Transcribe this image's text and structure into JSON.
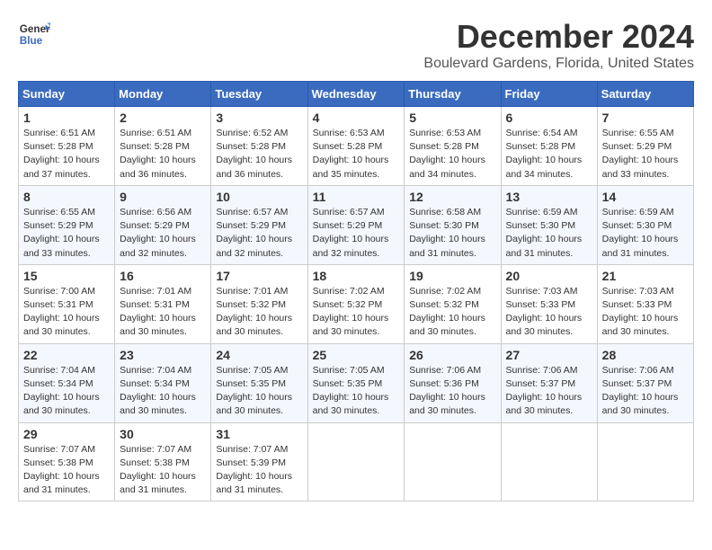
{
  "logo": {
    "text_line1": "General",
    "text_line2": "Blue"
  },
  "header": {
    "month_title": "December 2024",
    "location": "Boulevard Gardens, Florida, United States"
  },
  "days_of_week": [
    "Sunday",
    "Monday",
    "Tuesday",
    "Wednesday",
    "Thursday",
    "Friday",
    "Saturday"
  ],
  "weeks": [
    [
      {
        "day": "1",
        "info": "Sunrise: 6:51 AM\nSunset: 5:28 PM\nDaylight: 10 hours\nand 37 minutes."
      },
      {
        "day": "2",
        "info": "Sunrise: 6:51 AM\nSunset: 5:28 PM\nDaylight: 10 hours\nand 36 minutes."
      },
      {
        "day": "3",
        "info": "Sunrise: 6:52 AM\nSunset: 5:28 PM\nDaylight: 10 hours\nand 36 minutes."
      },
      {
        "day": "4",
        "info": "Sunrise: 6:53 AM\nSunset: 5:28 PM\nDaylight: 10 hours\nand 35 minutes."
      },
      {
        "day": "5",
        "info": "Sunrise: 6:53 AM\nSunset: 5:28 PM\nDaylight: 10 hours\nand 34 minutes."
      },
      {
        "day": "6",
        "info": "Sunrise: 6:54 AM\nSunset: 5:28 PM\nDaylight: 10 hours\nand 34 minutes."
      },
      {
        "day": "7",
        "info": "Sunrise: 6:55 AM\nSunset: 5:29 PM\nDaylight: 10 hours\nand 33 minutes."
      }
    ],
    [
      {
        "day": "8",
        "info": "Sunrise: 6:55 AM\nSunset: 5:29 PM\nDaylight: 10 hours\nand 33 minutes."
      },
      {
        "day": "9",
        "info": "Sunrise: 6:56 AM\nSunset: 5:29 PM\nDaylight: 10 hours\nand 32 minutes."
      },
      {
        "day": "10",
        "info": "Sunrise: 6:57 AM\nSunset: 5:29 PM\nDaylight: 10 hours\nand 32 minutes."
      },
      {
        "day": "11",
        "info": "Sunrise: 6:57 AM\nSunset: 5:29 PM\nDaylight: 10 hours\nand 32 minutes."
      },
      {
        "day": "12",
        "info": "Sunrise: 6:58 AM\nSunset: 5:30 PM\nDaylight: 10 hours\nand 31 minutes."
      },
      {
        "day": "13",
        "info": "Sunrise: 6:59 AM\nSunset: 5:30 PM\nDaylight: 10 hours\nand 31 minutes."
      },
      {
        "day": "14",
        "info": "Sunrise: 6:59 AM\nSunset: 5:30 PM\nDaylight: 10 hours\nand 31 minutes."
      }
    ],
    [
      {
        "day": "15",
        "info": "Sunrise: 7:00 AM\nSunset: 5:31 PM\nDaylight: 10 hours\nand 30 minutes."
      },
      {
        "day": "16",
        "info": "Sunrise: 7:01 AM\nSunset: 5:31 PM\nDaylight: 10 hours\nand 30 minutes."
      },
      {
        "day": "17",
        "info": "Sunrise: 7:01 AM\nSunset: 5:32 PM\nDaylight: 10 hours\nand 30 minutes."
      },
      {
        "day": "18",
        "info": "Sunrise: 7:02 AM\nSunset: 5:32 PM\nDaylight: 10 hours\nand 30 minutes."
      },
      {
        "day": "19",
        "info": "Sunrise: 7:02 AM\nSunset: 5:32 PM\nDaylight: 10 hours\nand 30 minutes."
      },
      {
        "day": "20",
        "info": "Sunrise: 7:03 AM\nSunset: 5:33 PM\nDaylight: 10 hours\nand 30 minutes."
      },
      {
        "day": "21",
        "info": "Sunrise: 7:03 AM\nSunset: 5:33 PM\nDaylight: 10 hours\nand 30 minutes."
      }
    ],
    [
      {
        "day": "22",
        "info": "Sunrise: 7:04 AM\nSunset: 5:34 PM\nDaylight: 10 hours\nand 30 minutes."
      },
      {
        "day": "23",
        "info": "Sunrise: 7:04 AM\nSunset: 5:34 PM\nDaylight: 10 hours\nand 30 minutes."
      },
      {
        "day": "24",
        "info": "Sunrise: 7:05 AM\nSunset: 5:35 PM\nDaylight: 10 hours\nand 30 minutes."
      },
      {
        "day": "25",
        "info": "Sunrise: 7:05 AM\nSunset: 5:35 PM\nDaylight: 10 hours\nand 30 minutes."
      },
      {
        "day": "26",
        "info": "Sunrise: 7:06 AM\nSunset: 5:36 PM\nDaylight: 10 hours\nand 30 minutes."
      },
      {
        "day": "27",
        "info": "Sunrise: 7:06 AM\nSunset: 5:37 PM\nDaylight: 10 hours\nand 30 minutes."
      },
      {
        "day": "28",
        "info": "Sunrise: 7:06 AM\nSunset: 5:37 PM\nDaylight: 10 hours\nand 30 minutes."
      }
    ],
    [
      {
        "day": "29",
        "info": "Sunrise: 7:07 AM\nSunset: 5:38 PM\nDaylight: 10 hours\nand 31 minutes."
      },
      {
        "day": "30",
        "info": "Sunrise: 7:07 AM\nSunset: 5:38 PM\nDaylight: 10 hours\nand 31 minutes."
      },
      {
        "day": "31",
        "info": "Sunrise: 7:07 AM\nSunset: 5:39 PM\nDaylight: 10 hours\nand 31 minutes."
      },
      {
        "day": "",
        "info": ""
      },
      {
        "day": "",
        "info": ""
      },
      {
        "day": "",
        "info": ""
      },
      {
        "day": "",
        "info": ""
      }
    ]
  ]
}
